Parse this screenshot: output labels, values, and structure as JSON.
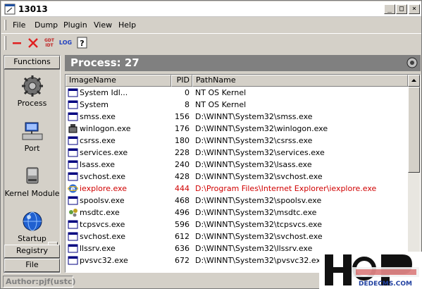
{
  "window": {
    "title": "13013"
  },
  "menu": [
    "File",
    "Dump",
    "Plugin",
    "View",
    "Help"
  ],
  "toolbar": {
    "tool3_label": "GDT IDT",
    "tool4_label": "LOG"
  },
  "sidebar": {
    "header": "Functions",
    "buttons": [
      {
        "label": "Process",
        "icon": "gear-icon"
      },
      {
        "label": "Port",
        "icon": "network-port-icon"
      },
      {
        "label": "Kernel Module",
        "icon": "disk-module-icon"
      },
      {
        "label": "Startup",
        "icon": "globe-startup-icon"
      }
    ],
    "sections": [
      "Registry",
      "File"
    ]
  },
  "main": {
    "title": "Process: 27"
  },
  "table": {
    "columns": [
      "ImageName",
      "PID",
      "PathName"
    ],
    "rows": [
      {
        "name": "System Idl...",
        "pid": "0",
        "path": "NT OS Kernel",
        "icon": "window-icon"
      },
      {
        "name": "System",
        "pid": "8",
        "path": "NT OS Kernel",
        "icon": "window-icon"
      },
      {
        "name": "smss.exe",
        "pid": "156",
        "path": "D:\\WINNT\\System32\\smss.exe",
        "icon": "window-icon"
      },
      {
        "name": "winlogon.exe",
        "pid": "176",
        "path": "D:\\WINNT\\System32\\winlogon.exe",
        "icon": "winlogon-icon"
      },
      {
        "name": "csrss.exe",
        "pid": "180",
        "path": "D:\\WINNT\\System32\\csrss.exe",
        "icon": "window-icon"
      },
      {
        "name": "services.exe",
        "pid": "228",
        "path": "D:\\WINNT\\System32\\services.exe",
        "icon": "window-icon"
      },
      {
        "name": "lsass.exe",
        "pid": "240",
        "path": "D:\\WINNT\\System32\\lsass.exe",
        "icon": "window-icon"
      },
      {
        "name": "svchost.exe",
        "pid": "428",
        "path": "D:\\WINNT\\System32\\svchost.exe",
        "icon": "window-icon"
      },
      {
        "name": "iexplore.exe",
        "pid": "444",
        "path": "D:\\Program Files\\Internet Explorer\\iexplore.exe",
        "icon": "ie-icon",
        "highlight": true
      },
      {
        "name": "spoolsv.exe",
        "pid": "468",
        "path": "D:\\WINNT\\System32\\spoolsv.exe",
        "icon": "window-icon"
      },
      {
        "name": "msdtc.exe",
        "pid": "496",
        "path": "D:\\WINNT\\System32\\msdtc.exe",
        "icon": "msdtc-icon"
      },
      {
        "name": "tcpsvcs.exe",
        "pid": "596",
        "path": "D:\\WINNT\\System32\\tcpsvcs.exe",
        "icon": "window-icon"
      },
      {
        "name": "svchost.exe",
        "pid": "612",
        "path": "D:\\WINNT\\System32\\svchost.exe",
        "icon": "window-icon"
      },
      {
        "name": "llssrv.exe",
        "pid": "636",
        "path": "D:\\WINNT\\System32\\llssrv.exe",
        "icon": "window-icon"
      },
      {
        "name": "pvsvc32.exe",
        "pid": "672",
        "path": "D:\\WINNT\\System32\\pvsvc32.exe",
        "icon": "window-icon"
      }
    ]
  },
  "status": {
    "text": "Author:pjf(ustc)"
  },
  "colors": {
    "highlight_row": "#d00000",
    "header_bg": "#808080",
    "face": "#d4d0c8"
  },
  "watermark": {
    "text": "DEDECMS.COM"
  }
}
